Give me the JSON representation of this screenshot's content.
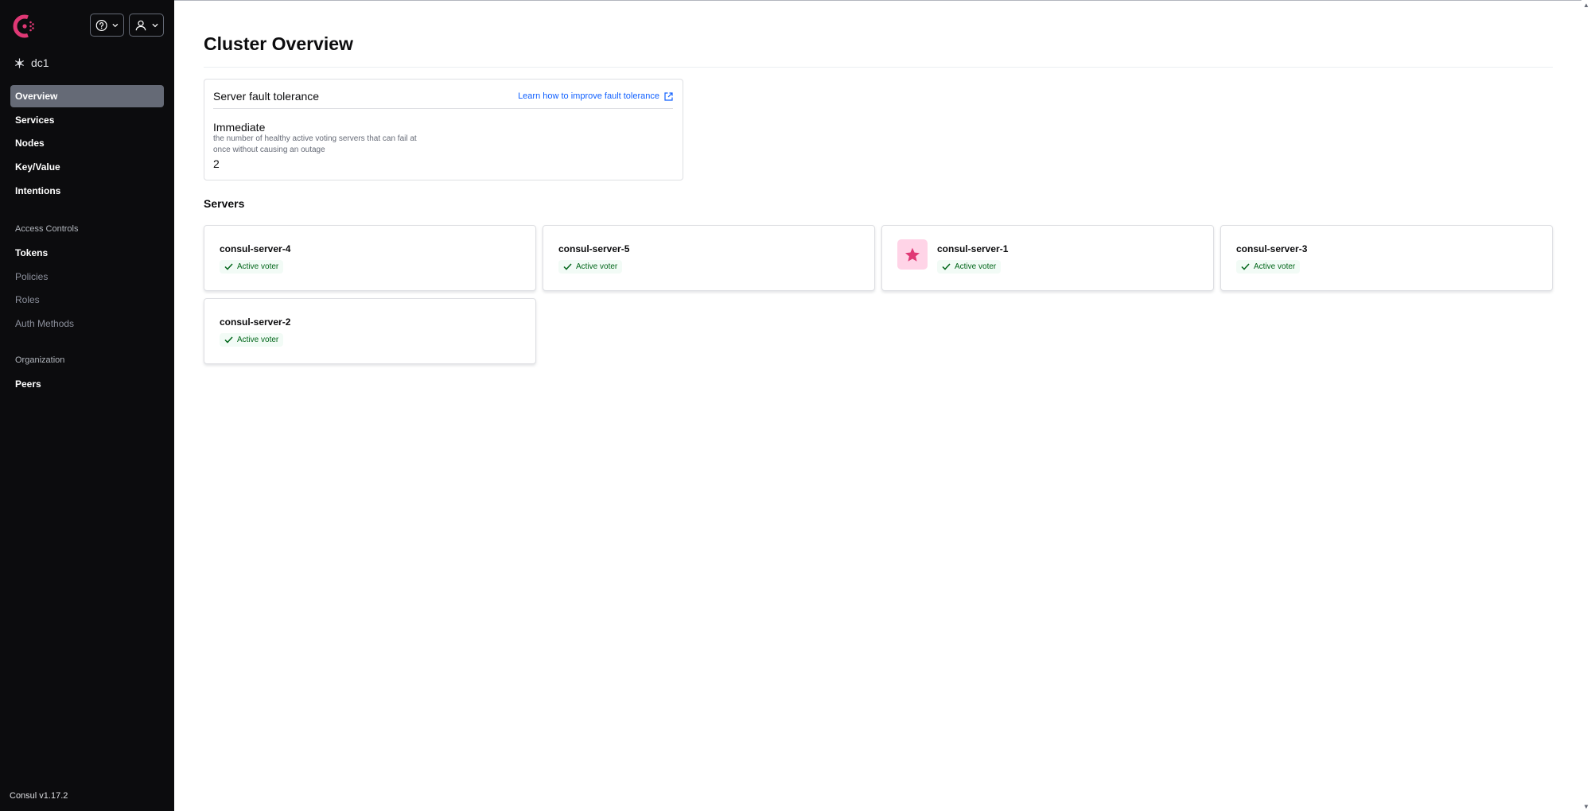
{
  "brand": {
    "accent": "#e03875",
    "product_version": "Consul v1.17.2"
  },
  "header": {
    "help_icon": "help-icon",
    "user_icon": "user-icon"
  },
  "datacenter": {
    "name": "dc1"
  },
  "nav": {
    "primary": [
      {
        "label": "Overview",
        "active": true
      },
      {
        "label": "Services"
      },
      {
        "label": "Nodes"
      },
      {
        "label": "Key/Value"
      },
      {
        "label": "Intentions"
      }
    ],
    "access_controls_heading": "Access Controls",
    "access_controls": [
      {
        "label": "Tokens"
      },
      {
        "label": "Policies"
      },
      {
        "label": "Roles"
      },
      {
        "label": "Auth Methods"
      }
    ],
    "organization_heading": "Organization",
    "organization": [
      {
        "label": "Peers"
      }
    ]
  },
  "page": {
    "title": "Cluster Overview"
  },
  "fault_tolerance": {
    "title": "Server fault tolerance",
    "learn_link": "Learn how to improve fault tolerance",
    "level": "Immediate",
    "description": "the number of healthy active voting servers that can fail at once without causing an outage",
    "value": "2"
  },
  "servers": {
    "title": "Servers",
    "items": [
      {
        "name": "consul-server-4",
        "status": "Active voter",
        "leader": false
      },
      {
        "name": "consul-server-5",
        "status": "Active voter",
        "leader": false
      },
      {
        "name": "consul-server-1",
        "status": "Active voter",
        "leader": true
      },
      {
        "name": "consul-server-3",
        "status": "Active voter",
        "leader": false
      },
      {
        "name": "consul-server-2",
        "status": "Active voter",
        "leader": false
      }
    ]
  }
}
